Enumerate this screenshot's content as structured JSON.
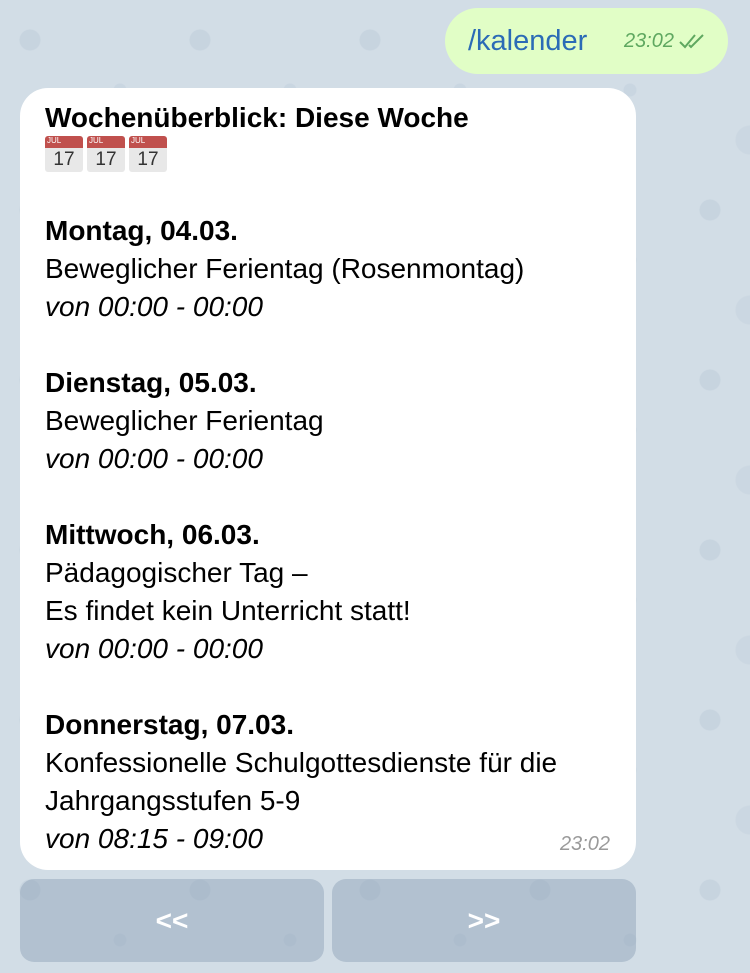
{
  "outgoing": {
    "text": "/kalender",
    "time": "23:02"
  },
  "incoming": {
    "title": "Wochenüberblick: Diese Woche",
    "calendar_icons": [
      {
        "month": "JUL",
        "day": "17"
      },
      {
        "month": "JUL",
        "day": "17"
      },
      {
        "month": "JUL",
        "day": "17"
      }
    ],
    "days": [
      {
        "day": "Montag, 04.03.",
        "desc": [
          "Beweglicher Ferientag (Rosenmontag)"
        ],
        "time": "von 00:00 - 00:00"
      },
      {
        "day": "Dienstag, 05.03.",
        "desc": [
          "Beweglicher Ferientag"
        ],
        "time": "von 00:00 - 00:00"
      },
      {
        "day": "Mittwoch, 06.03.",
        "desc": [
          "Pädagogischer Tag –",
          "Es findet kein Unterricht statt!"
        ],
        "time": "von 00:00 - 00:00"
      },
      {
        "day": "Donnerstag, 07.03.",
        "desc": [
          "Konfessionelle Schulgottesdienste für die",
          "Jahrgangsstufen 5-9"
        ],
        "time": "von 08:15 - 09:00"
      }
    ],
    "time": "23:02"
  },
  "keyboard": {
    "prev_label": "<<",
    "next_label": ">>"
  },
  "colors": {
    "outgoing_bubble": "#e1fec6",
    "outgoing_text": "#2b6bb6",
    "read_check": "#5fa860",
    "background": "#d2dde6"
  }
}
